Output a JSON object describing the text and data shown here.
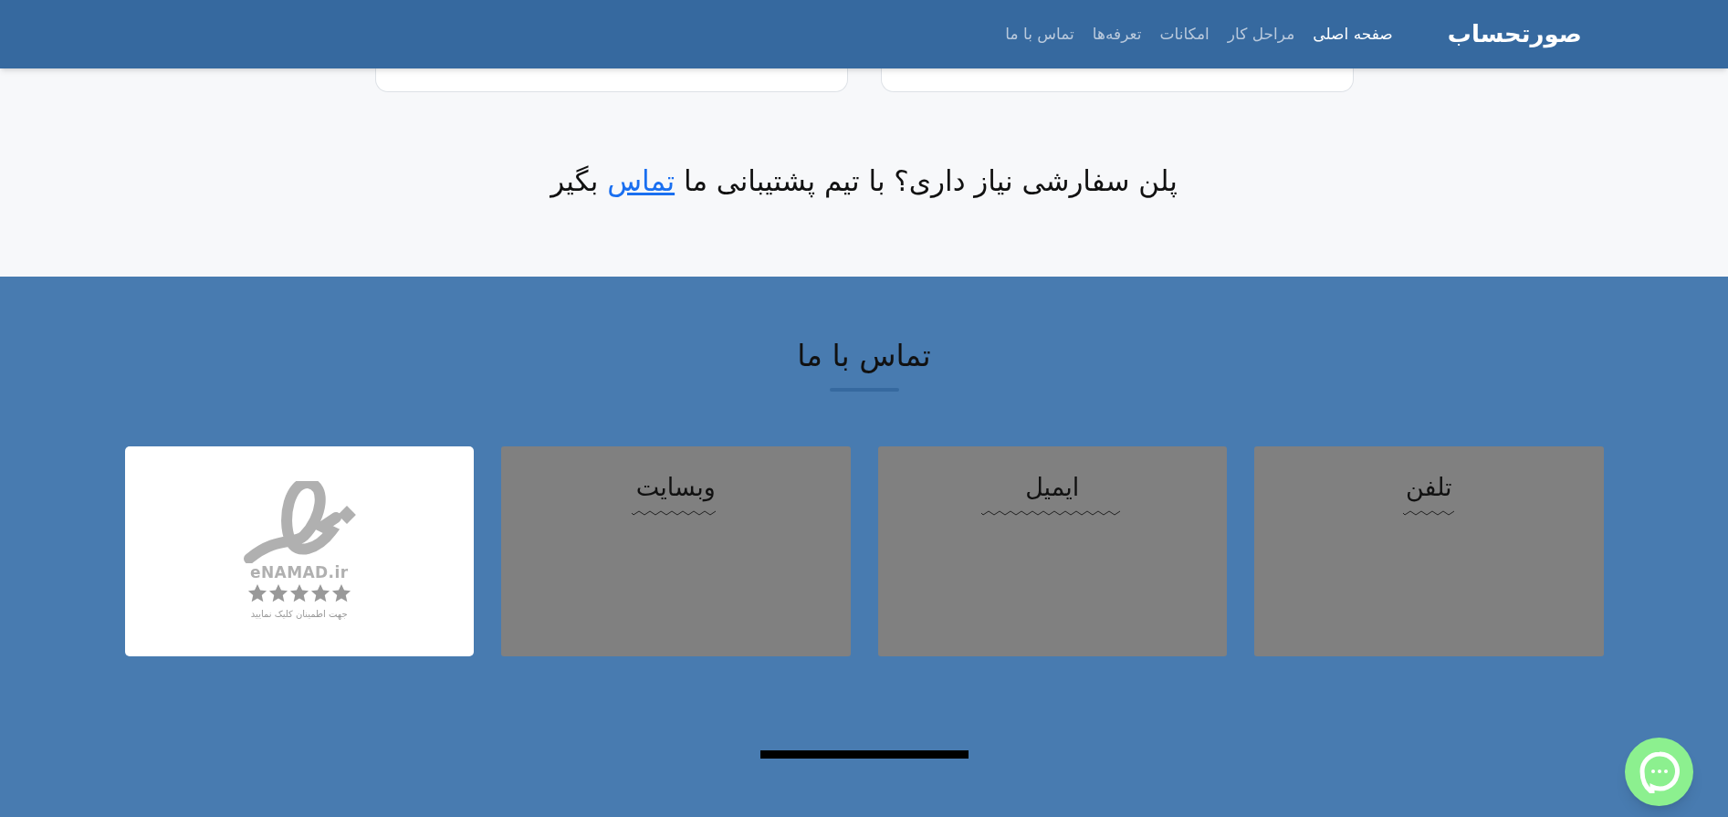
{
  "header": {
    "brand": "صورتحساب",
    "nav": [
      {
        "label": "صفحه اصلی",
        "selected": true
      },
      {
        "label": "مراحل کار",
        "selected": false
      },
      {
        "label": "امکانات",
        "selected": false
      },
      {
        "label": "تعرفه‌ها",
        "selected": false
      },
      {
        "label": "تماس با ما",
        "selected": false
      }
    ]
  },
  "cta": {
    "text_before": "پلن سفارشی نیاز داری؟ با تیم پشتیبانی ما",
    "link": "تماس",
    "text_after": "بگیر"
  },
  "contact": {
    "title": "تماس با ما",
    "cards": [
      {
        "kind": "info",
        "title": "تلفن"
      },
      {
        "kind": "info",
        "title": "ایمیل"
      },
      {
        "kind": "info",
        "title": "وبسایت"
      },
      {
        "kind": "badge",
        "brand": "eNAMAD.ir",
        "caption": "جهت اطمینان کلیک نمایید",
        "stars": 5
      }
    ]
  }
}
